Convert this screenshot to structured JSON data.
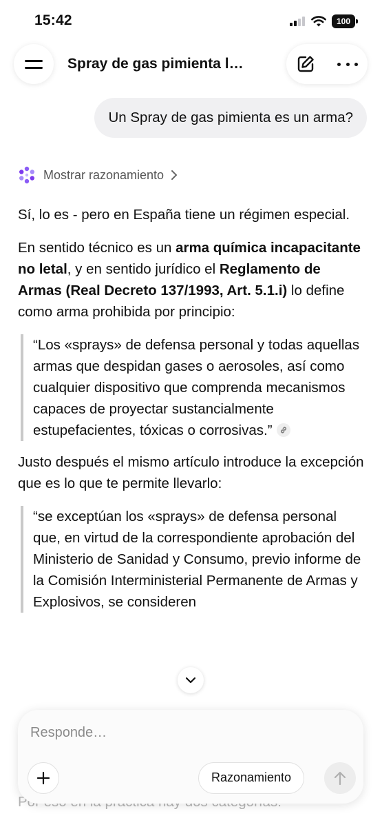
{
  "status_bar": {
    "time": "15:42",
    "battery_level": "100",
    "icons": [
      "cellular-signal-icon",
      "wifi-icon",
      "battery-icon"
    ]
  },
  "header": {
    "title": "Spray de gas pimienta l…",
    "icons": [
      "hamburger-menu-icon",
      "new-chat-edit-icon",
      "more-options-icon"
    ]
  },
  "conversation": {
    "user_message": "Un Spray de gas pimienta es un arma?",
    "reasoning_label": "Mostrar razonamiento",
    "answer": {
      "p1": "Sí, lo es - pero en España tiene un régimen especial.",
      "p2": {
        "t1": "En sentido técnico es un ",
        "b1": "arma química incapacitante no letal",
        "t2": ", y en sentido jurídico el ",
        "b2": "Reglamento de Armas (Real Decreto 137/1993, Art. 5.1.i)",
        "t3": " lo define como arma prohibida por principio:"
      },
      "quote1": "“Los «sprays» de defensa personal y todas aquellas armas que despidan gases o aerosoles, así como cualquier dispositivo que comprenda mecanismos capaces de proyectar sustancialmente estupefacientes, tóxicas o corrosivas.”",
      "p3": "Justo después el mismo artículo introduce la excepción que es lo que te permite llevarlo:",
      "quote2": "“se exceptúan los «sprays» de defensa personal que, en virtud de la correspondiente aprobación del Ministerio de Sanidad y Consumo, previo informe de la Comisión Interministerial Permanente de Armas y Explosivos, se consideren",
      "trailing_text": "Por eso en la práctica hay dos categorías:"
    }
  },
  "composer": {
    "placeholder": "Responde…",
    "reasoning_button": "Razonamiento",
    "icons": [
      "plus-icon",
      "send-arrow-icon"
    ]
  },
  "colors": {
    "bubble_bg": "#f0f0f2",
    "quote_border": "#c9c9c9",
    "reasoning_icon": "#8b5cf6"
  }
}
